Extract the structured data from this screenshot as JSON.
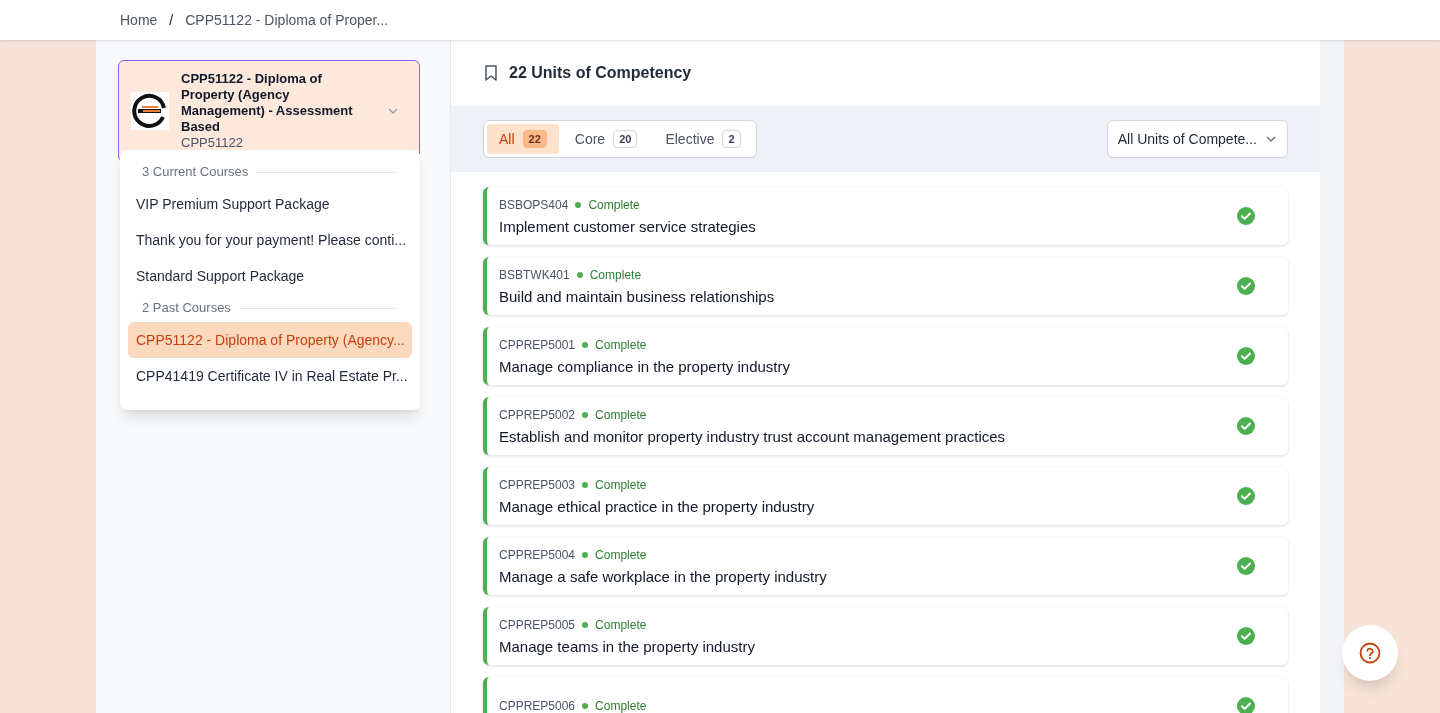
{
  "breadcrumb": {
    "separator": "/",
    "items": [
      "Home",
      "CPP51122 - Diploma of Proper..."
    ]
  },
  "course_selector": {
    "title": "CPP51122 - Diploma of Property (Agency Management) - Assessment Based",
    "code": "CPP51122",
    "expanded": true
  },
  "course_menu": [
    {
      "label": "3 Current Courses",
      "items": [
        {
          "label": "VIP Premium Support Package",
          "selected": false
        },
        {
          "label": "Thank you for your payment! Please conti...",
          "selected": false
        },
        {
          "label": "Standard Support Package",
          "selected": false
        }
      ]
    },
    {
      "label": "2 Past Courses",
      "items": [
        {
          "label": "CPP51122 - Diploma of Property (Agency...",
          "selected": true
        },
        {
          "label": "CPP41419 Certificate IV in Real Estate Pr...",
          "selected": false
        }
      ]
    }
  ],
  "units_title": "22 Units of Competency",
  "tabs": [
    {
      "label": "All",
      "count": "22",
      "selected": true
    },
    {
      "label": "Core",
      "count": "20",
      "selected": false
    },
    {
      "label": "Elective",
      "count": "2",
      "selected": false
    }
  ],
  "filter": {
    "value": "All Units of Compete..."
  },
  "units": [
    {
      "code": "BSBOPS404",
      "status": "Complete",
      "complete": true,
      "title": "Implement customer service strategies"
    },
    {
      "code": "BSBTWK401",
      "status": "Complete",
      "complete": true,
      "title": "Build and maintain business relationships"
    },
    {
      "code": "CPPREP5001",
      "status": "Complete",
      "complete": true,
      "title": "Manage compliance in the property industry"
    },
    {
      "code": "CPPREP5002",
      "status": "Complete",
      "complete": true,
      "title": "Establish and monitor property industry trust account management practices"
    },
    {
      "code": "CPPREP5003",
      "status": "Complete",
      "complete": true,
      "title": "Manage ethical practice in the property industry"
    },
    {
      "code": "CPPREP5004",
      "status": "Complete",
      "complete": true,
      "title": "Manage a safe workplace in the property industry"
    },
    {
      "code": "CPPREP5005",
      "status": "Complete",
      "complete": true,
      "title": "Manage teams in the property industry"
    },
    {
      "code": "CPPREP5006",
      "status": "Complete",
      "complete": true
    }
  ]
}
